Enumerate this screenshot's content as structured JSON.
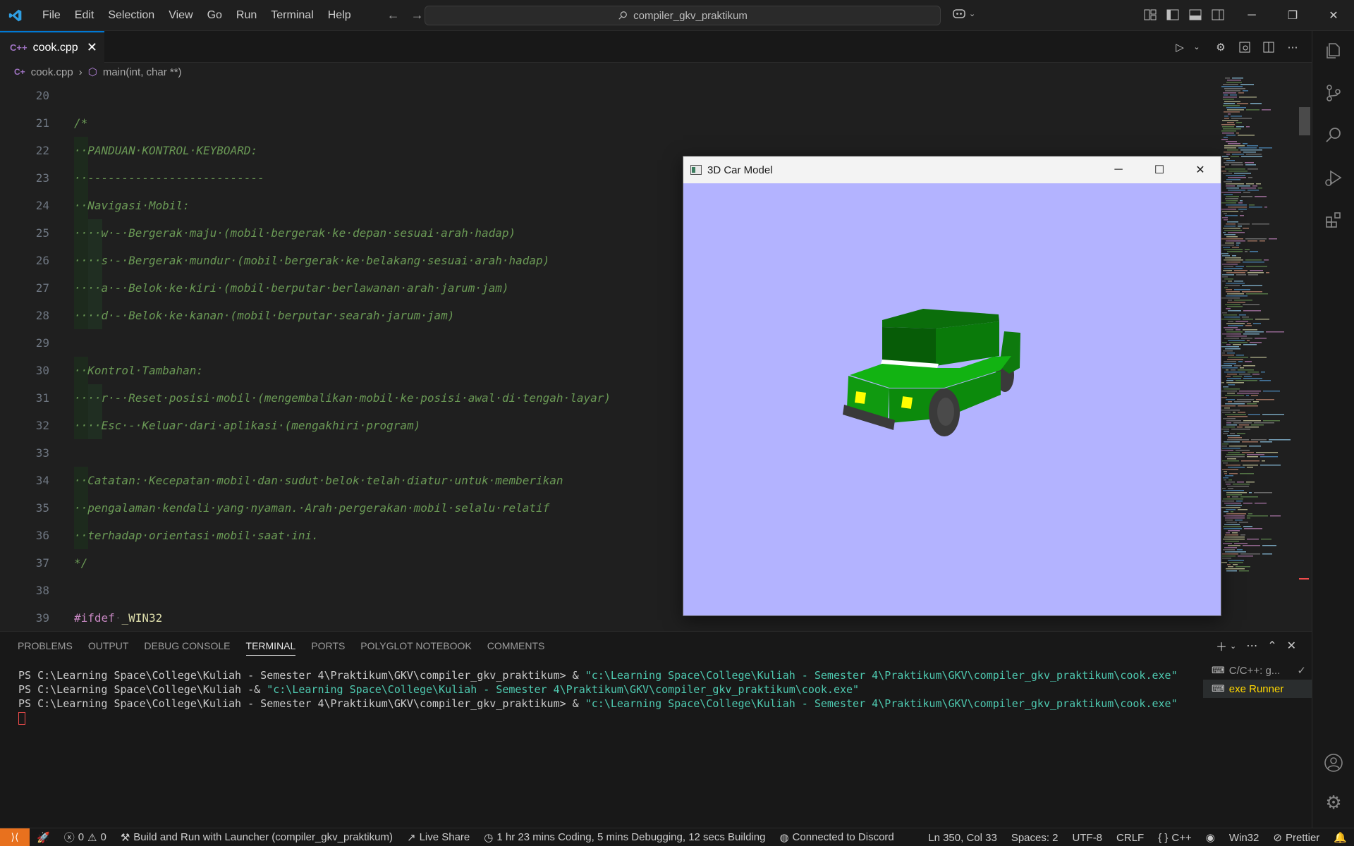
{
  "titlebar": {
    "menu": [
      "File",
      "Edit",
      "Selection",
      "View",
      "Go",
      "Run",
      "Terminal",
      "Help"
    ],
    "search": "compiler_gkv_praktikum",
    "window_controls": [
      "minimize-icon",
      "restore-icon",
      "close-icon"
    ]
  },
  "tab": {
    "label": "cook.cpp",
    "icon": "C++"
  },
  "breadcrumb": {
    "file": "cook.cpp",
    "symbol": "main(int, char **)"
  },
  "editor": {
    "lines": [
      {
        "n": "20",
        "text": ""
      },
      {
        "n": "21",
        "text": "/*"
      },
      {
        "n": "22",
        "text": "··PANDUAN·KONTROL·KEYBOARD:"
      },
      {
        "n": "23",
        "text": "··--------------------------"
      },
      {
        "n": "24",
        "text": "··Navigasi·Mobil:"
      },
      {
        "n": "25",
        "text": "····w·-·Bergerak·maju·(mobil·bergerak·ke·depan·sesuai·arah·hadap)"
      },
      {
        "n": "26",
        "text": "····s·-·Bergerak·mundur·(mobil·bergerak·ke·belakang·sesuai·arah·hadap)"
      },
      {
        "n": "27",
        "text": "····a·-·Belok·ke·kiri·(mobil·berputar·berlawanan·arah·jarum·jam)"
      },
      {
        "n": "28",
        "text": "····d·-·Belok·ke·kanan·(mobil·berputar·searah·jarum·jam)"
      },
      {
        "n": "29",
        "text": ""
      },
      {
        "n": "30",
        "text": "··Kontrol·Tambahan:"
      },
      {
        "n": "31",
        "text": "····r·-·Reset·posisi·mobil·(mengembalikan·mobil·ke·posisi·awal·di·tengah·layar)"
      },
      {
        "n": "32",
        "text": "····Esc·-·Keluar·dari·aplikasi·(mengakhiri·program)"
      },
      {
        "n": "33",
        "text": ""
      },
      {
        "n": "34",
        "text": "··Catatan:·Kecepatan·mobil·dan·sudut·belok·telah·diatur·untuk·memberikan"
      },
      {
        "n": "35",
        "text": "··pengalaman·kendali·yang·nyaman.·Arah·pergerakan·mobil·selalu·relatif"
      },
      {
        "n": "36",
        "text": "··terhadap·orientasi·mobil·saat·ini."
      },
      {
        "n": "37",
        "text": "*/"
      },
      {
        "n": "38",
        "text": ""
      },
      {
        "n": "39",
        "directive": "#ifdef",
        "macro": "_WIN32"
      }
    ]
  },
  "glwindow": {
    "title": "3D Car Model"
  },
  "panel": {
    "tabs": [
      "PROBLEMS",
      "OUTPUT",
      "DEBUG CONSOLE",
      "TERMINAL",
      "PORTS",
      "POLYGLOT NOTEBOOK",
      "COMMENTS"
    ],
    "active_tab": "TERMINAL",
    "terminal_lines": [
      {
        "prompt": "PS C:\\Learning Space\\College\\Kuliah - Semester 4\\Praktikum\\GKV\\compiler_gkv_praktikum> & ",
        "cmd": "\"c:\\Learning Space\\College\\Kuliah - Semester 4\\Praktikum\\GKV\\compiler_gkv_praktikum\\cook.exe\""
      },
      {
        "prompt": "PS C:\\Learning Space\\College\\Kuliah -& ",
        "cmd": "\"c:\\Learning Space\\College\\Kuliah - Semester 4\\Praktikum\\GKV\\compiler_gkv_praktikum\\cook.exe\""
      },
      {
        "prompt": "PS C:\\Learning Space\\College\\Kuliah - Semester 4\\Praktikum\\GKV\\compiler_gkv_praktikum> & ",
        "cmd": "\"c:\\Learning Space\\College\\Kuliah - Semester 4\\Praktikum\\GKV\\compiler_gkv_praktikum\\cook.exe\""
      }
    ],
    "terminal_list": [
      "C/C++: g...",
      "exe Runner"
    ]
  },
  "statusbar": {
    "problems_errors": "0",
    "problems_warnings": "0",
    "build": "Build and Run with Launcher (compiler_gkv_praktikum)",
    "liveshare": "Live Share",
    "time": "1 hr 23 mins Coding, 5 mins Debugging, 12 secs Building",
    "discord": "Connected to Discord",
    "position": "Ln 350, Col 33",
    "spaces": "Spaces: 2",
    "encoding": "UTF-8",
    "eol": "CRLF",
    "language": "C++",
    "platform": "Win32",
    "formatter": "Prettier"
  },
  "colors": {
    "accent": "#0078d4",
    "comment": "#6a9955",
    "canvas": "#b3b3ff",
    "car_green": "#1a9a1a"
  }
}
